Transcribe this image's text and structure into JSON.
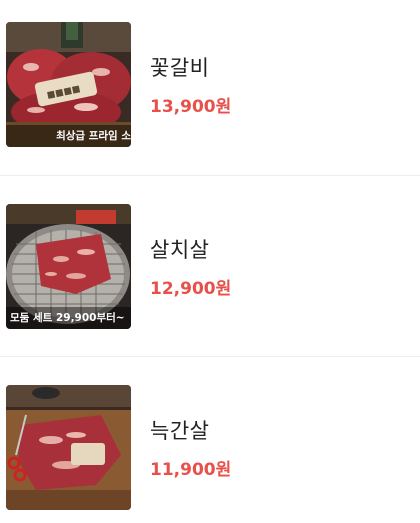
{
  "colors": {
    "price": "#e8504a",
    "name": "#222222",
    "divider": "#eeeeee"
  },
  "menu": {
    "items": [
      {
        "name": "꽃갈비",
        "price": "13,900원",
        "caption": "최상급 프라임 소",
        "image": "grilled-marbled-beef-rib-photo"
      },
      {
        "name": "살치살",
        "price": "12,900원",
        "caption": "모둠 세트 29,900부터~",
        "image": "beef-on-charcoal-grill-photo"
      },
      {
        "name": "늑간살",
        "price": "11,900원",
        "caption": "",
        "image": "sliced-beef-on-board-with-scissors-photo"
      }
    ]
  }
}
